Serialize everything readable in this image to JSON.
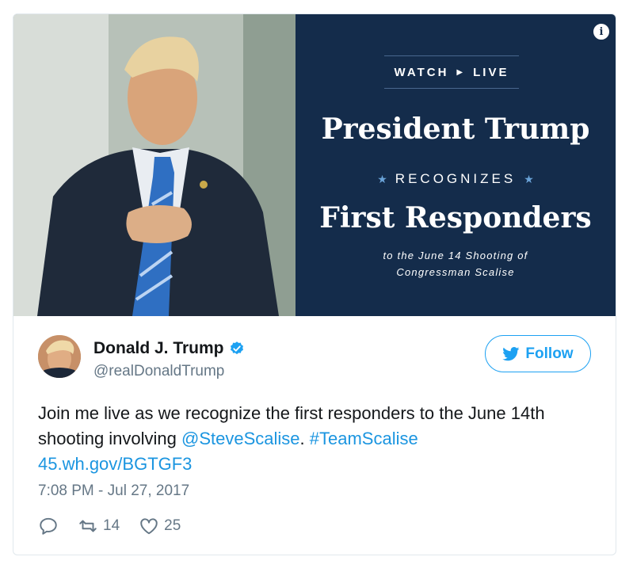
{
  "media": {
    "watch_label": "WATCH",
    "live_label": "LIVE",
    "headline_1": "President Trump",
    "recognizes": "RECOGNIZES",
    "headline_2": "First Responders",
    "sub_1": "to the June 14 Shooting of",
    "sub_2": "Congressman Scalise",
    "banner_color": "#142c4b"
  },
  "author": {
    "name": "Donald J. Trump",
    "handle": "@realDonaldTrump",
    "verified_icon": "verified-badge-icon"
  },
  "follow": {
    "label": "Follow",
    "icon": "twitter-bird-icon",
    "color": "#1da1f2"
  },
  "tweet": {
    "text_1": "Join me live as we recognize the first responders to the June 14th shooting involving ",
    "mention": "@SteveScalise",
    "text_2": ". ",
    "hashtag": "#TeamScalise",
    "url": "45.wh.gov/BGTGF3",
    "link_color": "#1b95e0"
  },
  "timestamp": "7:08 PM - Jul 27, 2017",
  "actions": {
    "retweets": "14",
    "likes": "25"
  }
}
